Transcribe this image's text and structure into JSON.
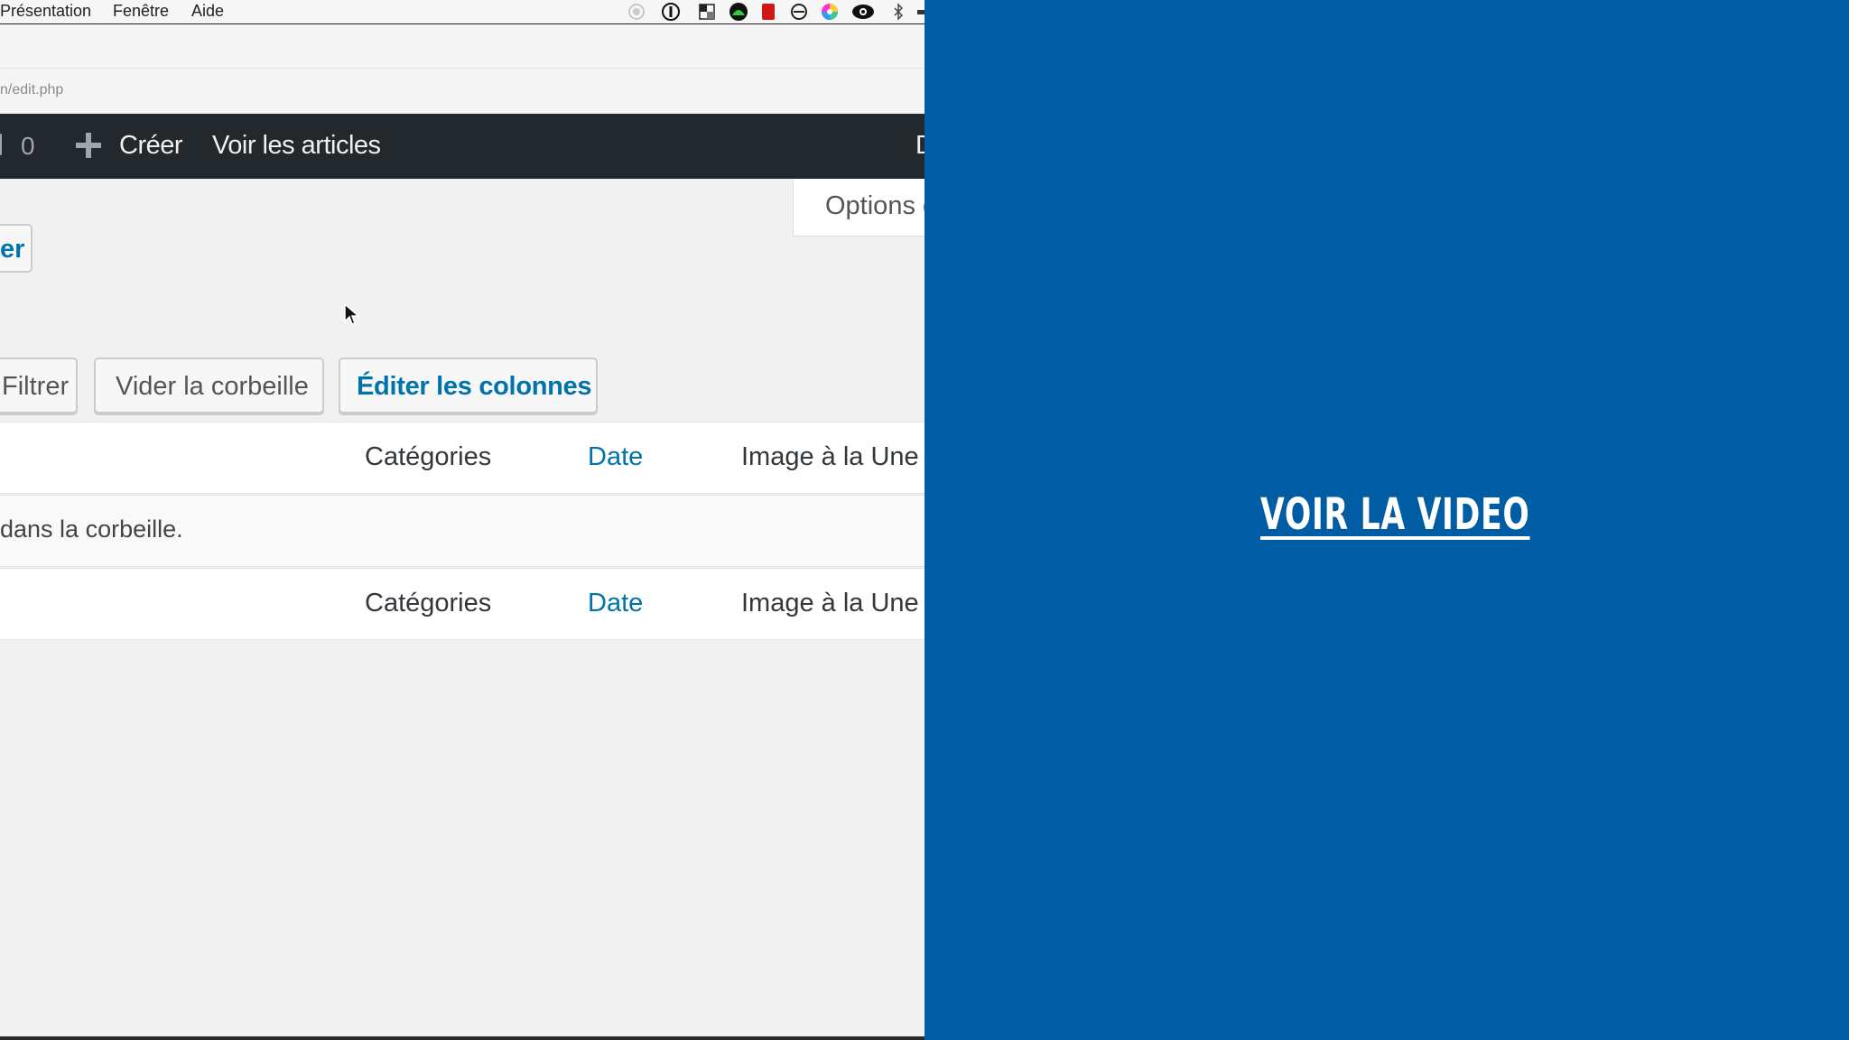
{
  "menubar": {
    "items": [
      "Présentation",
      "Fenêtre",
      "Aide"
    ],
    "tray_icons": [
      "record-icon",
      "info-icon",
      "grid-app-icon",
      "green-dot-icon",
      "red-app-icon",
      "forbidden-icon",
      "color-wheel-icon",
      "eye-icon",
      "bluetooth-icon"
    ]
  },
  "browser": {
    "url": "n/edit.php"
  },
  "admin_bar": {
    "comment_count": "0",
    "create_label": "Créer",
    "view_label": "Voir les articles",
    "cut_label": "D"
  },
  "screen_options": {
    "label": "Options d"
  },
  "top_button": {
    "label": "er"
  },
  "actions": {
    "filter_label": "Filtrer",
    "empty_trash_label": "Vider la corbeille",
    "edit_columns_label": "Éditer les colonnes"
  },
  "table": {
    "columns": [
      "Catégories",
      "Date",
      "Image à la Une"
    ],
    "empty_message": "dans la corbeille."
  },
  "promo": {
    "video_link": "VOIR LA VIDEO",
    "background": "#005da4"
  }
}
